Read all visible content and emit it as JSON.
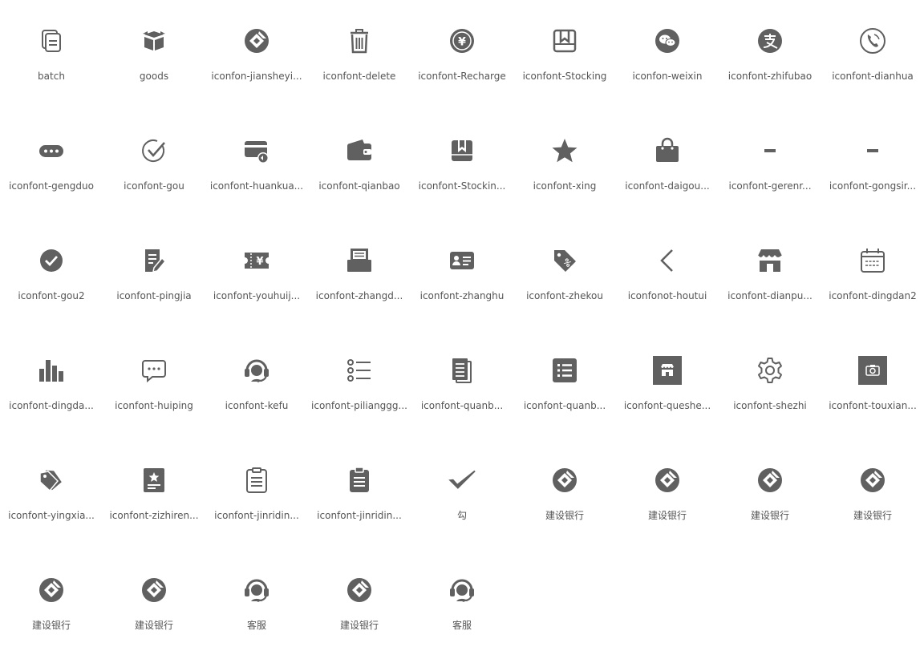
{
  "icon_color": "#606060",
  "icons": [
    {
      "label": "batch",
      "icon": "copy-documents-icon"
    },
    {
      "label": "goods",
      "icon": "package-box-icon"
    },
    {
      "label": "iconfon-jiansheyi...",
      "icon": "ccb-bank-logo-icon"
    },
    {
      "label": "iconfont-delete",
      "icon": "trash-can-icon"
    },
    {
      "label": "iconfont-Recharge",
      "icon": "yen-coin-icon"
    },
    {
      "label": "iconfont-Stocking",
      "icon": "bookmark-box-icon"
    },
    {
      "label": "iconfon-weixin",
      "icon": "wechat-icon"
    },
    {
      "label": "iconfont-zhifubao",
      "icon": "alipay-icon"
    },
    {
      "label": "iconfont-dianhua",
      "icon": "phone-icon"
    },
    {
      "label": "iconfont-gengduo",
      "icon": "more-dots-icon"
    },
    {
      "label": "iconfont-gou",
      "icon": "check-circle-outline-icon"
    },
    {
      "label": "iconfont-huankua...",
      "icon": "card-repay-icon"
    },
    {
      "label": "iconfont-qianbao",
      "icon": "wallet-icon"
    },
    {
      "label": "iconfont-Stockin...",
      "icon": "bookmark-solid-icon"
    },
    {
      "label": "iconfont-xing",
      "icon": "star-icon"
    },
    {
      "label": "iconfont-daigou...",
      "icon": "shopping-bag-icon"
    },
    {
      "label": "iconfont-gerenr...",
      "icon": "minus-icon"
    },
    {
      "label": "iconfont-gongsir...",
      "icon": "minus-icon"
    },
    {
      "label": "iconfont-gou2",
      "icon": "check-circle-solid-icon"
    },
    {
      "label": "iconfont-pingjia",
      "icon": "edit-document-icon"
    },
    {
      "label": "iconfont-youhuij...",
      "icon": "coupon-ticket-icon"
    },
    {
      "label": "iconfont-zhangd...",
      "icon": "bill-box-icon"
    },
    {
      "label": "iconfont-zhanghu",
      "icon": "id-card-icon"
    },
    {
      "label": "iconfont-zhekou",
      "icon": "discount-tag-icon"
    },
    {
      "label": "iconfonot-houtui",
      "icon": "chevron-left-icon"
    },
    {
      "label": "iconfont-dianpu...",
      "icon": "storefront-icon"
    },
    {
      "label": "iconfont-dingdan2",
      "icon": "calendar-icon"
    },
    {
      "label": "iconfont-dingda...",
      "icon": "bar-chart-icon"
    },
    {
      "label": "iconfont-huiping",
      "icon": "chat-bubble-icon"
    },
    {
      "label": "iconfont-kefu",
      "icon": "headset-support-icon"
    },
    {
      "label": "iconfont-pilianggg...",
      "icon": "list-bullets-icon"
    },
    {
      "label": "iconfont-quanb...",
      "icon": "documents-stack-icon"
    },
    {
      "label": "iconfont-quanb...",
      "icon": "list-square-icon"
    },
    {
      "label": "iconfont-queshe...",
      "icon": "store-placeholder-icon"
    },
    {
      "label": "iconfont-shezhi",
      "icon": "gear-icon"
    },
    {
      "label": "iconfont-touxian...",
      "icon": "camera-square-icon"
    },
    {
      "label": "iconfont-yingxia...",
      "icon": "tags-icon"
    },
    {
      "label": "iconfont-zizhiren...",
      "icon": "certificate-star-icon"
    },
    {
      "label": "iconfont-jinridin...",
      "icon": "clipboard-outline-icon"
    },
    {
      "label": "iconfont-jinridin...",
      "icon": "clipboard-solid-icon"
    },
    {
      "label": "勾",
      "icon": "checkmark-icon"
    },
    {
      "label": "建设银行",
      "icon": "ccb-bank-logo-icon"
    },
    {
      "label": "建设银行",
      "icon": "ccb-bank-logo-icon"
    },
    {
      "label": "建设银行",
      "icon": "ccb-bank-logo-icon"
    },
    {
      "label": "建设银行",
      "icon": "ccb-bank-logo-icon"
    },
    {
      "label": "建设银行",
      "icon": "ccb-bank-logo-icon"
    },
    {
      "label": "建设银行",
      "icon": "ccb-bank-logo-icon"
    },
    {
      "label": "客服",
      "icon": "headset-support-icon"
    },
    {
      "label": "建设银行",
      "icon": "ccb-bank-logo-icon"
    },
    {
      "label": "客服",
      "icon": "headset-support-icon"
    }
  ]
}
